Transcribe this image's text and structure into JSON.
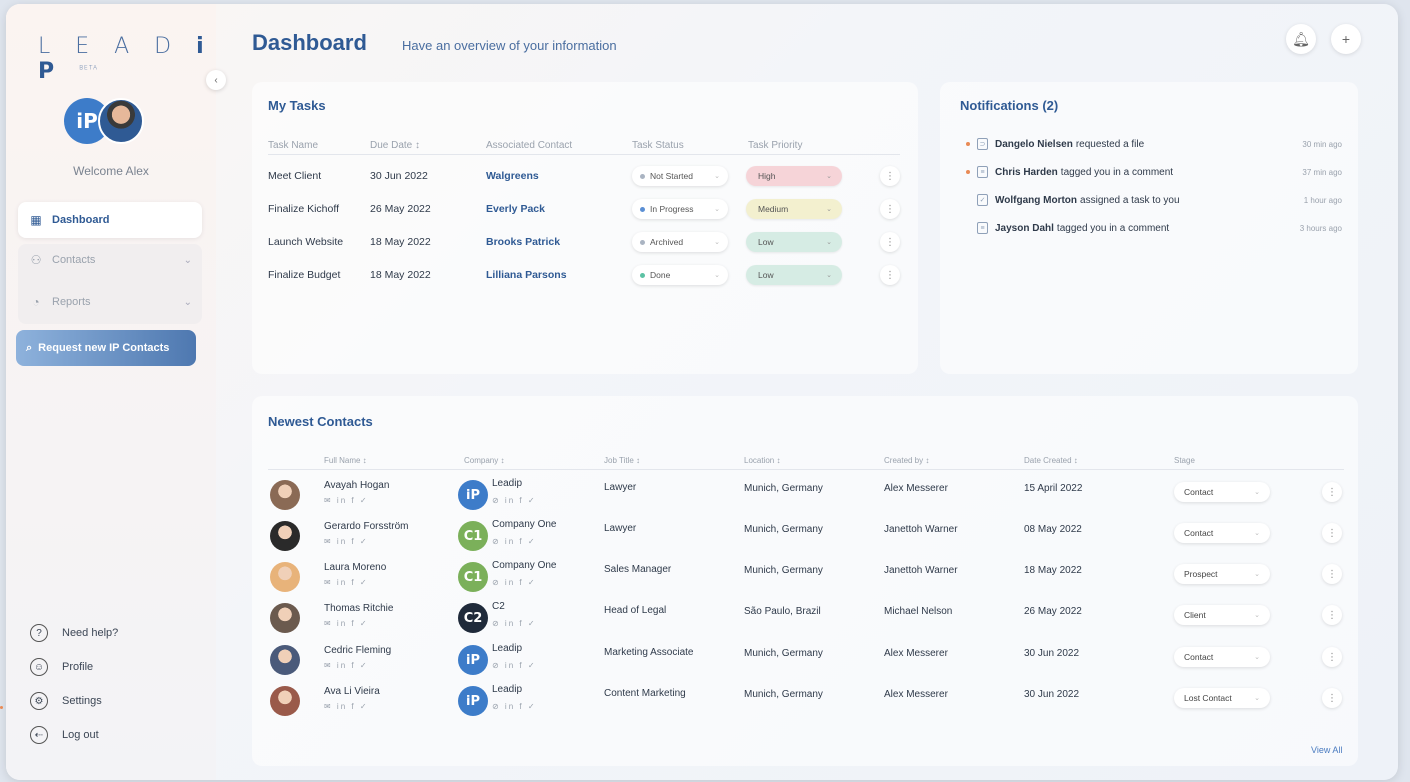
{
  "brand": {
    "logo_text": "LEADIP",
    "logo_tag": "BETA"
  },
  "sidebar": {
    "welcome": "Welcome Alex",
    "nav": [
      {
        "label": "Dashboard",
        "icon": "grid-icon"
      },
      {
        "label": "Contacts",
        "icon": "contacts-icon"
      },
      {
        "label": "Reports",
        "icon": "pie-chart-icon"
      }
    ],
    "request_button": "Request new IP Contacts",
    "bottom": [
      {
        "label": "Need help?",
        "icon": "help-icon"
      },
      {
        "label": "Profile",
        "icon": "profile-icon"
      },
      {
        "label": "Settings",
        "icon": "settings-icon"
      },
      {
        "label": "Log out",
        "icon": "logout-icon"
      }
    ]
  },
  "header": {
    "title": "Dashboard",
    "subtitle": "Have an overview of your information"
  },
  "tasks": {
    "title": "My Tasks",
    "columns": [
      "Task Name",
      "Due Date ↕",
      "Associated Contact",
      "Task Status",
      "Task Priority"
    ],
    "rows": [
      {
        "name": "Meet Client",
        "due": "30 Jun 2022",
        "contact": "Walgreens",
        "status": "Not Started",
        "status_color": "#aab4c2",
        "priority": "High",
        "priority_color": "#f6d4d8"
      },
      {
        "name": "Finalize Kichoff",
        "due": "26 May 2022",
        "contact": "Everly Pack",
        "status": "In Progress",
        "status_color": "#5b8fd4",
        "priority": "Medium",
        "priority_color": "#f3f0cf"
      },
      {
        "name": "Launch Website",
        "due": "18 May 2022",
        "contact": "Brooks Patrick",
        "status": "Archived",
        "status_color": "#aab4c2",
        "priority": "Low",
        "priority_color": "#d6ece4"
      },
      {
        "name": "Finalize Budget",
        "due": "18 May 2022",
        "contact": "Lilliana Parsons",
        "status": "Done",
        "status_color": "#5cc2a4",
        "priority": "Low",
        "priority_color": "#d6ece4"
      }
    ]
  },
  "notifications": {
    "title": "Notifications (2)",
    "items": [
      {
        "actor": "Dangelo Nielsen",
        "text": "requested a file",
        "time": "30 min ago",
        "unread": true,
        "icon": "paperclip-icon"
      },
      {
        "actor": "Chris Harden",
        "text": "tagged you in a comment",
        "time": "37 min ago",
        "unread": true,
        "icon": "comment-icon"
      },
      {
        "actor": "Wolfgang Morton",
        "text": "assigned a task to you",
        "time": "1 hour ago",
        "unread": false,
        "icon": "task-icon"
      },
      {
        "actor": "Jayson Dahl",
        "text": "tagged you in a comment",
        "time": "3 hours ago",
        "unread": false,
        "icon": "comment-icon"
      }
    ]
  },
  "contacts": {
    "title": "Newest Contacts",
    "columns": [
      "Full Name ↕",
      "Company ↕",
      "Job Title ↕",
      "Location ↕",
      "Created by ↕",
      "Date Created ↕",
      "Stage"
    ],
    "rows": [
      {
        "name": "Avayah Hogan",
        "company": "Leadip",
        "company_logo": "iP",
        "logo_color": "#3d7cc9",
        "job": "Lawyer",
        "location": "Munich, Germany",
        "created_by": "Alex Messerer",
        "date": "15 April 2022",
        "stage": "Contact",
        "avatar_color": "#8a6a55"
      },
      {
        "name": "Gerardo Forsström",
        "company": "Company One",
        "company_logo": "C1",
        "logo_color": "#7bb05a",
        "job": "Lawyer",
        "location": "Munich, Germany",
        "created_by": "Janettoh Warner",
        "date": "08 May 2022",
        "stage": "Contact",
        "avatar_color": "#2a2a2a"
      },
      {
        "name": "Laura Moreno",
        "company": "Company One",
        "company_logo": "C1",
        "logo_color": "#7bb05a",
        "job": "Sales Manager",
        "location": "Munich, Germany",
        "created_by": "Janettoh Warner",
        "date": "18 May 2022",
        "stage": "Prospect",
        "avatar_color": "#e8b37a"
      },
      {
        "name": "Thomas Ritchie",
        "company": "C2",
        "company_logo": "C2",
        "logo_color": "#1f2a3a",
        "job": "Head of Legal",
        "location": "São Paulo, Brazil",
        "created_by": "Michael Nelson",
        "date": "26 May 2022",
        "stage": "Client",
        "avatar_color": "#6b5a4e"
      },
      {
        "name": "Cedric Fleming",
        "company": "Leadip",
        "company_logo": "iP",
        "logo_color": "#3d7cc9",
        "job": "Marketing Associate",
        "location": "Munich, Germany",
        "created_by": "Alex Messerer",
        "date": "30 Jun 2022",
        "stage": "Contact",
        "avatar_color": "#4a5a7a"
      },
      {
        "name": "Ava Li Vieira",
        "company": "Leadip",
        "company_logo": "iP",
        "logo_color": "#3d7cc9",
        "job": "Content Marketing",
        "location": "Munich, Germany",
        "created_by": "Alex Messerer",
        "date": "30 Jun 2022",
        "stage": "Lost Contact",
        "avatar_color": "#9a5a4a"
      }
    ],
    "view_all": "View All"
  },
  "social_icons": "✉ in f ✓",
  "company_social_icons": "⊘ in f ✓"
}
